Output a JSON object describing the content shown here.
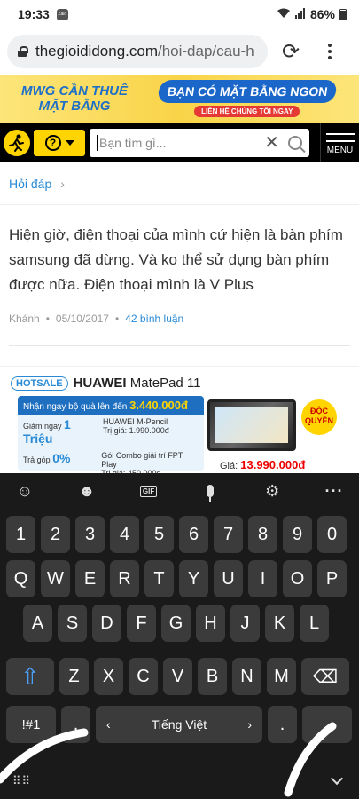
{
  "status": {
    "time": "19:33",
    "app_badge": "Zalo",
    "battery": "86%"
  },
  "browser": {
    "url_host": "thegioididong.com",
    "url_path": "/hoi-dap/cau-h"
  },
  "ad_banner": {
    "left_line1": "MWG CẦN THUÊ",
    "left_line2": "MẶT BẰNG",
    "right_main": "BẠN CÓ MẶT BẰNG NGON",
    "right_cta": "LIÊN HỆ CHÚNG TÔI NGAY"
  },
  "site_header": {
    "search_placeholder": "Bạn tìm gì...",
    "menu_label": "MENU",
    "q_icon": "?"
  },
  "breadcrumb": {
    "label": "Hỏi đáp",
    "separator": "›"
  },
  "question": {
    "text": "Hiện giờ, điện thoại của mình cứ hiện là bàn phím samsung đã dừng. Và ko thể sử dụng bàn phím được nữa. Điện thoại mình là V Plus",
    "author": "Khánh",
    "date": "05/10/2017",
    "comments": "42 bình luận"
  },
  "promo": {
    "hotsale": "HOTSALE",
    "brand": "HUAWEI",
    "product": "MatePad 11",
    "gift_label": "Nhận ngay bộ quà lên đến",
    "gift_value": "3.440.000đ",
    "discount_label": "Giảm ngay",
    "discount_value": "1 Triệu",
    "installment_label": "Trả góp",
    "installment_value": "0%",
    "pencil": "HUAWEI M-Pencil",
    "pencil_value": "Trị giá: 1.990.000đ",
    "combo": "Gói Combo giải trí",
    "combo_brand": "FPT Play",
    "combo_value": "Trị giá: 450.000đ",
    "exclusive": "ĐỘC QUYỀN",
    "price_label": "Giá:",
    "price": "13.990.000đ"
  },
  "keyboard": {
    "row1": [
      "1",
      "2",
      "3",
      "4",
      "5",
      "6",
      "7",
      "8",
      "9",
      "0"
    ],
    "row2": [
      "Q",
      "W",
      "E",
      "R",
      "T",
      "Y",
      "U",
      "I",
      "O",
      "P"
    ],
    "row3": [
      "A",
      "S",
      "D",
      "F",
      "G",
      "H",
      "J",
      "K",
      "L"
    ],
    "row4": [
      "Z",
      "X",
      "C",
      "V",
      "B",
      "N",
      "M"
    ],
    "symbols_key": "!#1",
    "comma_key": ",",
    "space_label": "Tiếng Việt",
    "period_key": ".",
    "gif_label": "GIF"
  }
}
